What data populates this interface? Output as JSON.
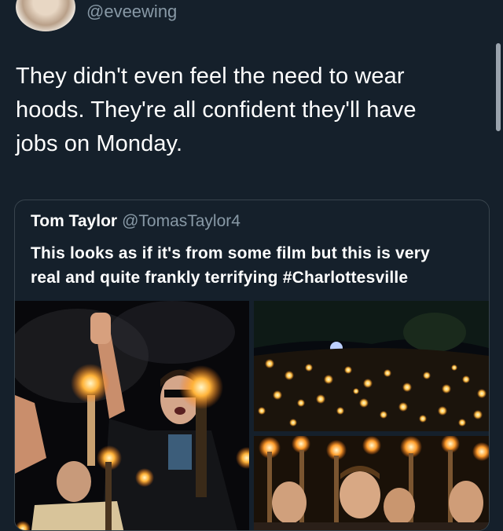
{
  "tweet": {
    "handle": "@eveewing",
    "text_lines": [
      "They didn't even feel the need to wear",
      "hoods. They're all confident they'll have",
      "jobs on Monday."
    ]
  },
  "quoted_tweet": {
    "name": "Tom Taylor",
    "handle": "@TomasTaylor4",
    "text_lines": [
      "This looks as if it's from some film but this is very",
      "real and quite frankly terrifying #Charlottesville"
    ]
  },
  "colors": {
    "background": "#15202b",
    "secondary_text": "#8899a6",
    "border": "#38444d"
  }
}
